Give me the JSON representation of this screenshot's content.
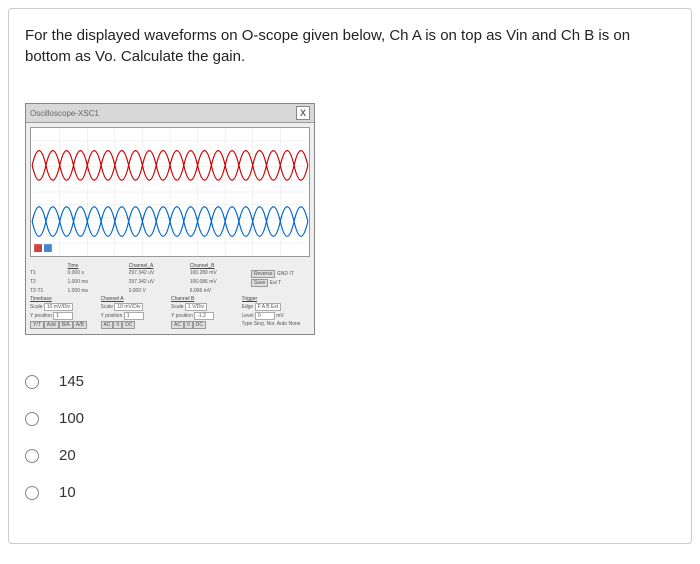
{
  "question": "For the displayed waveforms on O-scope given below, Ch A is on top as Vin and Ch B is on bottom as Vo. Calculate the gain.",
  "scope": {
    "window_title": "Oscilloscope-XSC1",
    "close_glyph": "X",
    "timebase": {
      "header": "Timebase",
      "t1_label": "T1",
      "t2_label": "T2",
      "t21_label": "T2-T1",
      "time_col": "Time",
      "v1": "0.000 s",
      "v2": "1.000 ms",
      "v3": "1.000 ms"
    },
    "chA": {
      "header": "Channel_A",
      "scale": "297.342 uV",
      "v2": "297.342 uV",
      "v3": "0.000 V",
      "sect": "Channel A",
      "scale_label": "Scale",
      "ypos_label": "Y position",
      "scale_val": "10 mV/Div",
      "ypos_val": "1"
    },
    "chB": {
      "header": "Channel_B",
      "scale": "100.280 mV",
      "v2": "106.086 mV",
      "v3": "6.006 mV",
      "sect": "Channel B",
      "scale_label": "Scale",
      "ypos_label": "Y position",
      "scale_val": "1 V/Div",
      "ypos_val": "-1.2"
    },
    "trigger": {
      "reverse": "Reverse",
      "save": "Save",
      "gnd": "GND IT",
      "ext": "Ext T",
      "sect": "Trigger",
      "edge_label": "Edge",
      "edge_val": "F A B Ext",
      "level_label": "Level",
      "level_val": "0",
      "unit": "mV",
      "type": "Type Sing. Nor. Auto None"
    },
    "bottom": {
      "yt": "Y/T",
      "add": "Add",
      "ba": "B/A",
      "ab": "A/B",
      "ac1": "AC",
      "zero1": "0",
      "dc1": "DC",
      "ac2": "AC",
      "zero2": "0",
      "dc2": "DC"
    }
  },
  "answers": [
    {
      "label": "145"
    },
    {
      "label": "100"
    },
    {
      "label": "20"
    },
    {
      "label": "10"
    }
  ]
}
